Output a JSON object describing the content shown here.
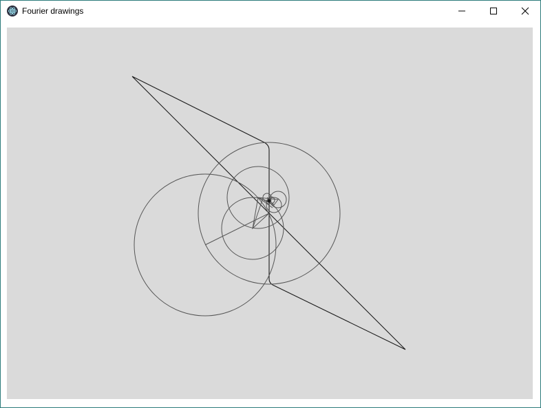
{
  "window": {
    "title": "Fourier drawings",
    "icon": "electron-atom-icon",
    "controls": [
      "minimize-icon",
      "maximize-icon",
      "close-icon"
    ]
  },
  "canvas": {
    "background": "#dadada",
    "path_color": "#1a1a1a",
    "epicycle_color": "#555555"
  }
}
